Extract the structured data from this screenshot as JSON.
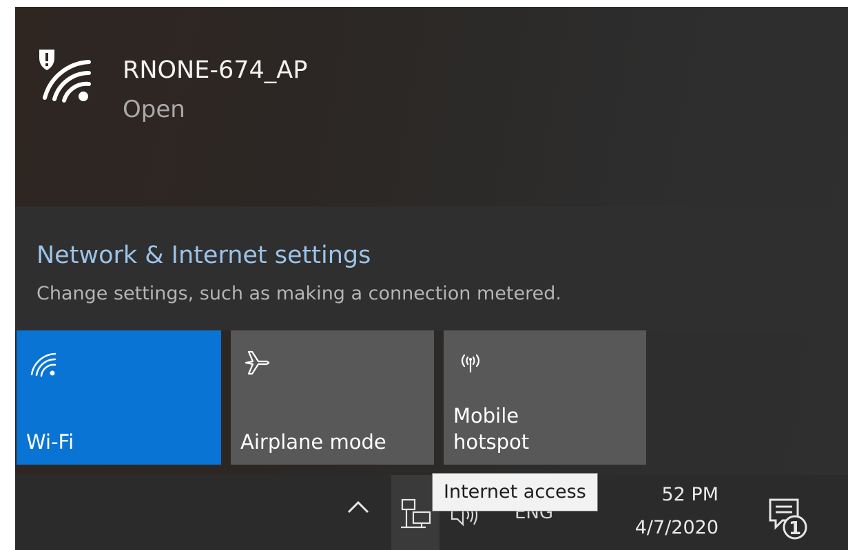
{
  "network": {
    "name": "RNONE-674_AP",
    "status": "Open",
    "icon": "wifi-shield-warning-icon"
  },
  "settings": {
    "title": "Network & Internet settings",
    "description": "Change settings, such as making a connection metered."
  },
  "quick_actions": [
    {
      "label": "Wi-Fi",
      "icon": "wifi-icon",
      "active": true
    },
    {
      "label": "Airplane mode",
      "icon": "airplane-icon",
      "active": false
    },
    {
      "label": "Mobile\nhotspot",
      "icon": "mobile-hotspot-icon",
      "active": false
    }
  ],
  "taskbar": {
    "language": "ENG",
    "time": "52 PM",
    "date": "4/7/2020",
    "notification_count": "1"
  },
  "tooltip": {
    "text": "Internet access"
  },
  "colors": {
    "accent": "#0a74d4",
    "link": "#9cc3e8",
    "tile": "#585858",
    "flyout_bg": "#2f2f2f"
  }
}
